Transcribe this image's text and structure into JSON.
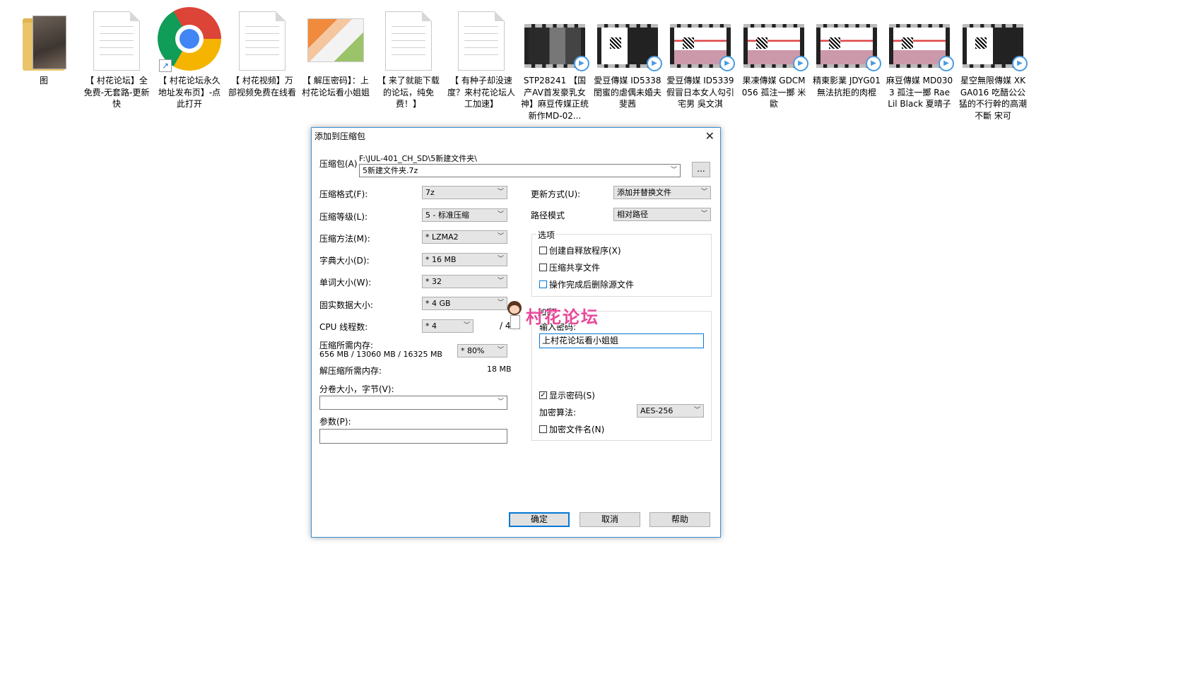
{
  "desktop": {
    "icons": [
      {
        "label": "图",
        "kind": "folder"
      },
      {
        "label": "【 村花论坛】全免费-无套路-更新快",
        "kind": "doc"
      },
      {
        "label": "【 村花论坛永久地址发布页】-点此打开",
        "kind": "chrome"
      },
      {
        "label": "【 村花视频】万部视频免费在线看",
        "kind": "doc"
      },
      {
        "label": "【 解压密码】：上村花论坛看小姐姐",
        "kind": "paint"
      },
      {
        "label": "【 来了就能下载的论坛，纯免费！】",
        "kind": "doc"
      },
      {
        "label": "【 有种子却没速度？来村花论坛人工加速】",
        "kind": "doc"
      },
      {
        "label": "STP28241 【国产AV首发豪乳女神】麻豆传媒正统新作MD-02...",
        "kind": "video-dark"
      },
      {
        "label": "愛豆傳媒 ID5338 閨蜜的虐偶未婚夫 斐茜",
        "kind": "video-mix"
      },
      {
        "label": "愛豆傳媒 ID5339 假冒日本女人勾引宅男 吳文淇",
        "kind": "video"
      },
      {
        "label": "果凍傳媒 GDCM056 孤注一擲 米歐",
        "kind": "video"
      },
      {
        "label": "精東影業 JDYG01 無法抗拒的肉棍",
        "kind": "video"
      },
      {
        "label": "麻豆傳媒 MD0303 孤注一擲 Rae Lil Black 夏晴子",
        "kind": "video"
      },
      {
        "label": "星空無限傳媒 XKGA016 吃醋公公猛的不行幹的高潮不斷 宋可",
        "kind": "video-mix"
      }
    ]
  },
  "dialog": {
    "title": "添加到压缩包",
    "archive_label": "压缩包(A)",
    "archive_path": "F:\\JUL-401_CH_SD\\5新建文件夹\\",
    "archive_name": "5新建文件夹.7z",
    "browse_label": "...",
    "format_label": "压缩格式(F):",
    "format_value": "7z",
    "level_label": "压缩等级(L):",
    "level_value": "5 - 标准压缩",
    "method_label": "压缩方法(M):",
    "method_value": "* LZMA2",
    "dict_label": "字典大小(D):",
    "dict_value": "* 16 MB",
    "word_label": "单词大小(W):",
    "word_value": "* 32",
    "solid_label": "固实数据大小:",
    "solid_value": "* 4 GB",
    "cpu_label": "CPU 线程数:",
    "cpu_value": "* 4",
    "cpu_total": "/ 4",
    "mem_label": "压缩所需内存:",
    "mem_detail": "656 MB / 13060 MB / 16325 MB",
    "mem_percent": "* 80%",
    "decomp_label": "解压缩所需内存:",
    "decomp_value": "18 MB",
    "split_label": "分卷大小，字节(V):",
    "split_value": "",
    "params_label": "参数(P):",
    "params_value": "",
    "update_label": "更新方式(U):",
    "update_value": "添加并替换文件",
    "pathmode_label": "路径模式",
    "pathmode_value": "相对路径",
    "options_label": "选项",
    "opt_sfx": "创建自释放程序(X)",
    "opt_shared": "压缩共享文件",
    "opt_delete": "操作完成后删除源文件",
    "enc_label": "加密",
    "pwd_label": "输入密码:",
    "pwd_value": "上村花论坛看小姐姐",
    "show_pwd": "显示密码(S)",
    "enc_method_label": "加密算法:",
    "enc_method_value": "AES-256",
    "enc_names": "加密文件名(N)",
    "ok": "确定",
    "cancel": "取消",
    "help": "帮助"
  },
  "watermark": {
    "text": "村花论坛"
  },
  "colors": {
    "accent": "#0078d7",
    "watermark": "#e8489a"
  }
}
